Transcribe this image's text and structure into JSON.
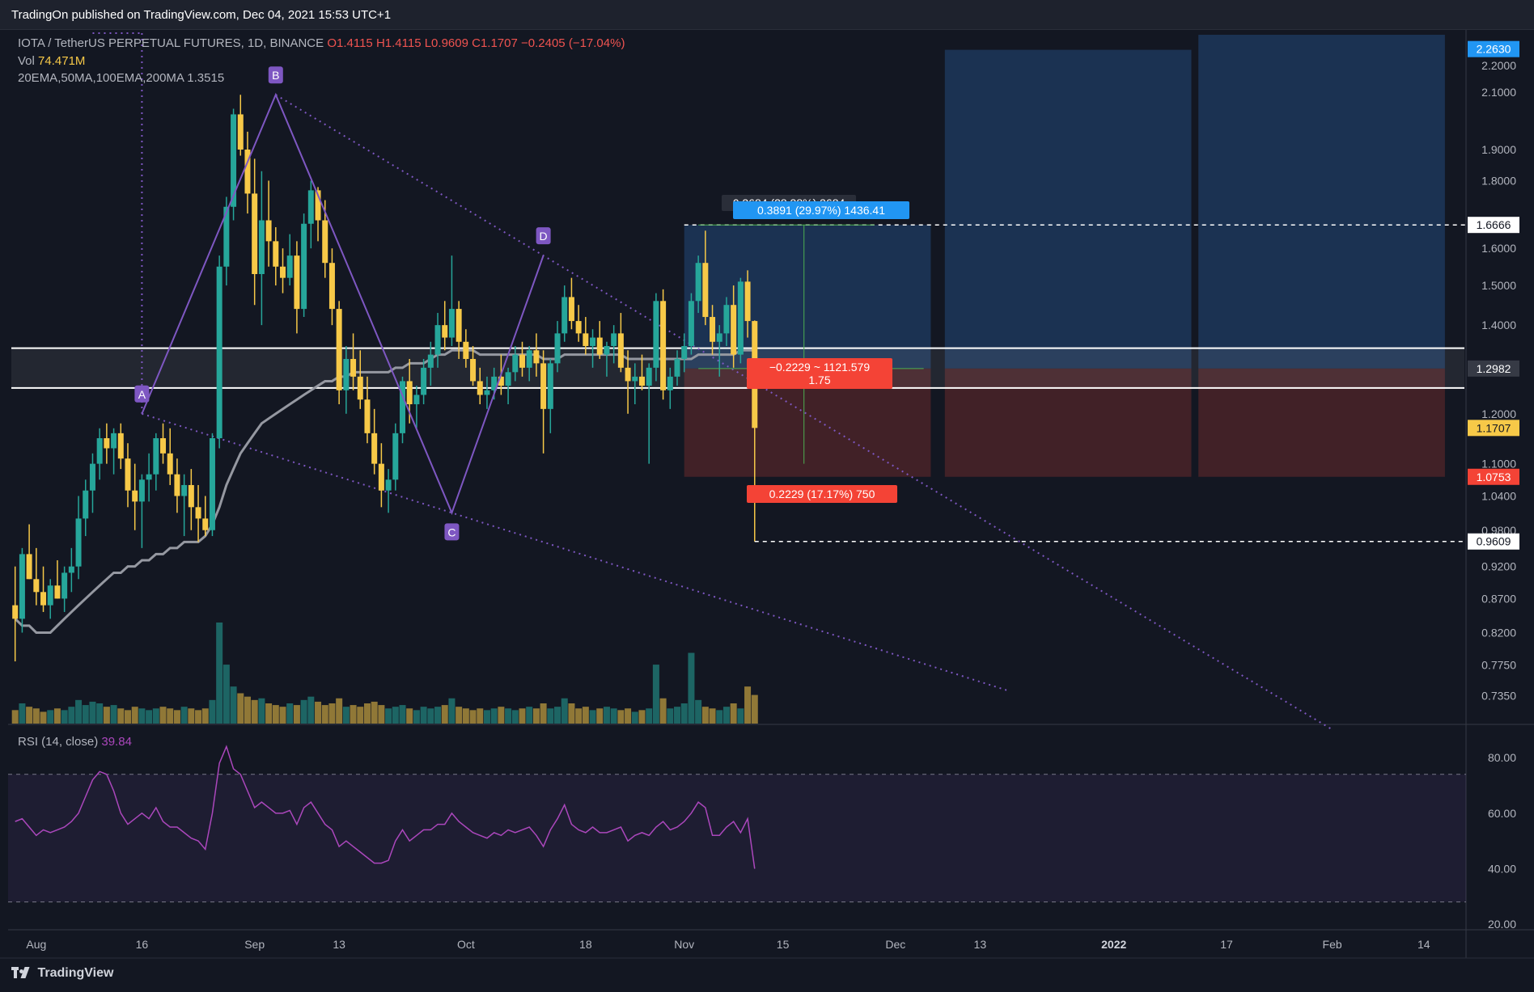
{
  "header": {
    "publish_text": "TradingOn published on TradingView.com, Dec 04, 2021 15:53 UTC+1"
  },
  "legend": {
    "symbol": "IOTA / TetherUS PERPETUAL FUTURES, 1D, BINANCE",
    "open": "O1.4115",
    "high": "H1.4115",
    "low": "L0.9609",
    "close": "C1.1707",
    "change": "−0.2405 (−17.04%)",
    "vol_label": "Vol",
    "vol_value": "74.471M",
    "ma_label": "20EMA,50MA,100EMA,200MA",
    "ma_value": "1.3515",
    "rsi_label": "RSI (14, close)",
    "rsi_value": "39.84"
  },
  "footer": {
    "brand": "TradingView"
  },
  "colors": {
    "bull": "#26a69a",
    "bear": "#f7c948",
    "pattern": "#7e57c2",
    "rsi": "#ab47bc",
    "ma": "#9598a1",
    "target_zone": "#1e3a5f",
    "stop_zone": "#4a2328"
  },
  "chart_data": [
    {
      "type": "candlestick",
      "title": "IOTA / TetherUS PERPETUAL FUTURES, 1D, BINANCE",
      "y_scale": "log",
      "ylim": [
        0.7,
        2.32
      ],
      "y_ticks": [
        "2.2000",
        "2.1000",
        "1.9000",
        "1.8000",
        "1.6000",
        "1.5000",
        "1.4000",
        "1.2000",
        "1.1000",
        "1.0400",
        "0.9800",
        "0.9200",
        "0.8700",
        "0.8200",
        "0.7750",
        "0.7350"
      ],
      "x_ticks": [
        "Aug",
        "16",
        "Sep",
        "13",
        "Oct",
        "18",
        "Nov",
        "15",
        "Dec",
        "13",
        "2022",
        "17",
        "Feb",
        "14"
      ],
      "x_range": [
        "2021-07-28",
        "2022-02-20"
      ],
      "ohlc_start": "2021-07-29",
      "ohlc": [
        [
          0.86,
          0.92,
          0.78,
          0.84
        ],
        [
          0.84,
          0.95,
          0.82,
          0.94
        ],
        [
          0.94,
          0.99,
          0.9,
          0.9
        ],
        [
          0.9,
          0.95,
          0.86,
          0.88
        ],
        [
          0.88,
          0.92,
          0.85,
          0.86
        ],
        [
          0.86,
          0.9,
          0.84,
          0.89
        ],
        [
          0.89,
          0.93,
          0.87,
          0.87
        ],
        [
          0.87,
          0.92,
          0.85,
          0.91
        ],
        [
          0.91,
          0.95,
          0.88,
          0.92
        ],
        [
          0.92,
          1.04,
          0.9,
          1.0
        ],
        [
          1.0,
          1.07,
          0.97,
          1.05
        ],
        [
          1.05,
          1.12,
          1.01,
          1.1
        ],
        [
          1.1,
          1.17,
          1.07,
          1.15
        ],
        [
          1.15,
          1.18,
          1.1,
          1.13
        ],
        [
          1.13,
          1.17,
          1.08,
          1.16
        ],
        [
          1.16,
          1.18,
          1.09,
          1.11
        ],
        [
          1.11,
          1.14,
          1.02,
          1.05
        ],
        [
          1.05,
          1.1,
          0.98,
          1.03
        ],
        [
          1.03,
          1.08,
          0.95,
          1.07
        ],
        [
          1.07,
          1.12,
          1.03,
          1.08
        ],
        [
          1.08,
          1.16,
          1.05,
          1.15
        ],
        [
          1.15,
          1.18,
          1.1,
          1.12
        ],
        [
          1.12,
          1.17,
          1.06,
          1.08
        ],
        [
          1.08,
          1.11,
          1.01,
          1.04
        ],
        [
          1.04,
          1.08,
          0.97,
          1.06
        ],
        [
          1.06,
          1.09,
          0.98,
          1.02
        ],
        [
          1.02,
          1.06,
          0.96,
          1.0
        ],
        [
          1.0,
          1.04,
          0.97,
          0.98
        ],
        [
          0.98,
          1.16,
          0.97,
          1.15
        ],
        [
          1.15,
          1.58,
          1.13,
          1.55
        ],
        [
          1.55,
          1.75,
          1.5,
          1.72
        ],
        [
          1.72,
          2.04,
          1.68,
          2.02
        ],
        [
          2.02,
          2.09,
          1.88,
          1.9
        ],
        [
          1.9,
          1.96,
          1.7,
          1.76
        ],
        [
          1.76,
          1.87,
          1.45,
          1.53
        ],
        [
          1.53,
          1.83,
          1.4,
          1.68
        ],
        [
          1.68,
          1.8,
          1.55,
          1.62
        ],
        [
          1.62,
          1.66,
          1.5,
          1.55
        ],
        [
          1.55,
          1.6,
          1.48,
          1.52
        ],
        [
          1.52,
          1.64,
          1.5,
          1.58
        ],
        [
          1.58,
          1.62,
          1.38,
          1.44
        ],
        [
          1.44,
          1.7,
          1.42,
          1.67
        ],
        [
          1.67,
          1.8,
          1.6,
          1.77
        ],
        [
          1.77,
          1.78,
          1.62,
          1.68
        ],
        [
          1.68,
          1.74,
          1.52,
          1.56
        ],
        [
          1.56,
          1.6,
          1.4,
          1.44
        ],
        [
          1.44,
          1.46,
          1.22,
          1.25
        ],
        [
          1.25,
          1.35,
          1.2,
          1.32
        ],
        [
          1.32,
          1.38,
          1.25,
          1.28
        ],
        [
          1.28,
          1.34,
          1.21,
          1.23
        ],
        [
          1.23,
          1.28,
          1.14,
          1.16
        ],
        [
          1.16,
          1.21,
          1.08,
          1.1
        ],
        [
          1.1,
          1.14,
          1.02,
          1.05
        ],
        [
          1.05,
          1.09,
          1.01,
          1.07
        ],
        [
          1.07,
          1.18,
          1.05,
          1.16
        ],
        [
          1.16,
          1.28,
          1.14,
          1.27
        ],
        [
          1.27,
          1.32,
          1.18,
          1.22
        ],
        [
          1.22,
          1.26,
          1.17,
          1.24
        ],
        [
          1.24,
          1.32,
          1.22,
          1.3
        ],
        [
          1.3,
          1.36,
          1.26,
          1.33
        ],
        [
          1.33,
          1.43,
          1.3,
          1.4
        ],
        [
          1.4,
          1.46,
          1.34,
          1.37
        ],
        [
          1.37,
          1.58,
          1.35,
          1.44
        ],
        [
          1.44,
          1.46,
          1.32,
          1.36
        ],
        [
          1.36,
          1.39,
          1.3,
          1.32
        ],
        [
          1.32,
          1.35,
          1.26,
          1.27
        ],
        [
          1.27,
          1.3,
          1.22,
          1.24
        ],
        [
          1.24,
          1.28,
          1.21,
          1.25
        ],
        [
          1.25,
          1.3,
          1.23,
          1.28
        ],
        [
          1.28,
          1.33,
          1.24,
          1.26
        ],
        [
          1.26,
          1.3,
          1.22,
          1.29
        ],
        [
          1.29,
          1.35,
          1.27,
          1.33
        ],
        [
          1.33,
          1.36,
          1.28,
          1.3
        ],
        [
          1.3,
          1.35,
          1.27,
          1.34
        ],
        [
          1.34,
          1.38,
          1.28,
          1.31
        ],
        [
          1.31,
          1.34,
          1.12,
          1.21
        ],
        [
          1.21,
          1.32,
          1.16,
          1.31
        ],
        [
          1.31,
          1.41,
          1.29,
          1.38
        ],
        [
          1.38,
          1.5,
          1.36,
          1.47
        ],
        [
          1.47,
          1.52,
          1.39,
          1.41
        ],
        [
          1.41,
          1.45,
          1.36,
          1.38
        ],
        [
          1.38,
          1.42,
          1.33,
          1.35
        ],
        [
          1.35,
          1.39,
          1.3,
          1.37
        ],
        [
          1.37,
          1.41,
          1.32,
          1.33
        ],
        [
          1.33,
          1.36,
          1.28,
          1.35
        ],
        [
          1.35,
          1.4,
          1.31,
          1.38
        ],
        [
          1.38,
          1.43,
          1.29,
          1.3
        ],
        [
          1.3,
          1.34,
          1.2,
          1.27
        ],
        [
          1.27,
          1.31,
          1.22,
          1.28
        ],
        [
          1.28,
          1.33,
          1.25,
          1.26
        ],
        [
          1.26,
          1.31,
          1.1,
          1.3
        ],
        [
          1.3,
          1.48,
          1.27,
          1.46
        ],
        [
          1.46,
          1.49,
          1.23,
          1.25
        ],
        [
          1.25,
          1.3,
          1.21,
          1.28
        ],
        [
          1.28,
          1.34,
          1.26,
          1.32
        ],
        [
          1.32,
          1.38,
          1.29,
          1.35
        ],
        [
          1.35,
          1.48,
          1.33,
          1.46
        ],
        [
          1.46,
          1.58,
          1.43,
          1.56
        ],
        [
          1.56,
          1.65,
          1.4,
          1.42
        ],
        [
          1.42,
          1.45,
          1.33,
          1.36
        ],
        [
          1.36,
          1.4,
          1.28,
          1.38
        ],
        [
          1.38,
          1.47,
          1.35,
          1.45
        ],
        [
          1.45,
          1.5,
          1.3,
          1.33
        ],
        [
          1.33,
          1.52,
          1.31,
          1.51
        ],
        [
          1.51,
          1.54,
          1.37,
          1.41
        ],
        [
          1.41,
          1.4115,
          0.9609,
          1.1707
        ]
      ],
      "volume_unit": "M",
      "volume": [
        8,
        12,
        10,
        9,
        7,
        8,
        9,
        8,
        10,
        14,
        11,
        13,
        12,
        10,
        11,
        9,
        8,
        10,
        9,
        8,
        9,
        10,
        9,
        8,
        10,
        9,
        8,
        9,
        14,
        60,
        35,
        22,
        18,
        16,
        14,
        15,
        12,
        11,
        10,
        12,
        11,
        14,
        16,
        13,
        11,
        12,
        15,
        10,
        11,
        10,
        12,
        13,
        11,
        9,
        10,
        11,
        9,
        8,
        10,
        9,
        10,
        11,
        15,
        10,
        9,
        8,
        9,
        8,
        9,
        10,
        9,
        8,
        9,
        10,
        9,
        12,
        9,
        10,
        15,
        12,
        9,
        10,
        8,
        9,
        10,
        9,
        8,
        9,
        7,
        8,
        9,
        35,
        15,
        9,
        10,
        12,
        42,
        14,
        10,
        9,
        8,
        10,
        12,
        9,
        22,
        17
      ],
      "moving_average": [
        0.84,
        0.83,
        0.83,
        0.82,
        0.82,
        0.82,
        0.83,
        0.84,
        0.85,
        0.86,
        0.87,
        0.88,
        0.89,
        0.9,
        0.91,
        0.91,
        0.92,
        0.92,
        0.93,
        0.93,
        0.94,
        0.94,
        0.95,
        0.95,
        0.96,
        0.96,
        0.96,
        0.97,
        0.99,
        1.02,
        1.06,
        1.09,
        1.12,
        1.14,
        1.16,
        1.18,
        1.19,
        1.2,
        1.21,
        1.22,
        1.23,
        1.24,
        1.25,
        1.26,
        1.27,
        1.27,
        1.28,
        1.28,
        1.29,
        1.29,
        1.29,
        1.29,
        1.29,
        1.29,
        1.3,
        1.3,
        1.31,
        1.31,
        1.31,
        1.32,
        1.33,
        1.33,
        1.34,
        1.34,
        1.34,
        1.34,
        1.33,
        1.33,
        1.33,
        1.33,
        1.33,
        1.33,
        1.33,
        1.33,
        1.33,
        1.32,
        1.32,
        1.32,
        1.33,
        1.33,
        1.33,
        1.33,
        1.33,
        1.33,
        1.33,
        1.33,
        1.33,
        1.32,
        1.32,
        1.32,
        1.32,
        1.32,
        1.32,
        1.32,
        1.32,
        1.32,
        1.32,
        1.33,
        1.33,
        1.33,
        1.33,
        1.33,
        1.33,
        1.34,
        1.34,
        1.34
      ],
      "rsi": [
        57,
        58,
        55,
        52,
        54,
        53,
        54,
        55,
        57,
        60,
        66,
        72,
        75,
        74,
        68,
        60,
        56,
        58,
        60,
        58,
        62,
        57,
        55,
        55,
        53,
        51,
        50,
        47,
        60,
        78,
        84,
        76,
        74,
        68,
        62,
        64,
        62,
        60,
        60,
        61,
        56,
        62,
        64,
        60,
        56,
        54,
        48,
        50,
        48,
        46,
        44,
        42,
        42,
        43,
        50,
        54,
        50,
        52,
        54,
        54,
        56,
        56,
        60,
        57,
        55,
        53,
        52,
        51,
        53,
        52,
        54,
        53,
        54,
        55,
        52,
        48,
        54,
        58,
        63,
        56,
        54,
        53,
        55,
        53,
        53,
        54,
        55,
        50,
        52,
        53,
        52,
        55,
        57,
        54,
        55,
        57,
        60,
        64,
        62,
        52,
        52,
        55,
        57,
        53,
        58,
        40
      ],
      "pattern_points": [
        {
          "label": "A",
          "date": "2021-08-16",
          "price": 1.2
        },
        {
          "label": "B",
          "date": "2021-09-04",
          "price": 2.09
        },
        {
          "label": "C",
          "date": "2021-09-29",
          "price": 1.01
        },
        {
          "label": "D",
          "date": "2021-10-12",
          "price": 1.58
        }
      ],
      "horizontal_levels": [
        1.6666,
        0.9609
      ],
      "zone_lines": [
        1.345,
        1.255
      ],
      "position": {
        "entry": 1.2982,
        "target": 1.6666,
        "stop": 1.0753,
        "target_label": "0.3891 (29.97%) 1436.41",
        "range_label": "0.3684 (28.38%) 3684",
        "stop_label": "0.2229 (17.17%) 750",
        "pnl_label": "−0.2229 ~ 1121.579",
        "ratio_label": "1.75"
      },
      "price_badges": [
        {
          "value": "2.2630",
          "color": "#2196f3"
        },
        {
          "value": "1.6666",
          "color": "#ffffff"
        },
        {
          "value": "1.2982",
          "color": "#363a45"
        },
        {
          "value": "1.1707",
          "color": "#f7c948"
        },
        {
          "value": "1.0753",
          "color": "#f44336"
        },
        {
          "value": "0.9609",
          "color": "#ffffff"
        }
      ],
      "rsi_ylim": [
        18,
        92
      ],
      "rsi_ticks": [
        "80.00",
        "60.00",
        "40.00",
        "20.00"
      ],
      "rsi_bands": [
        74,
        28
      ]
    }
  ]
}
